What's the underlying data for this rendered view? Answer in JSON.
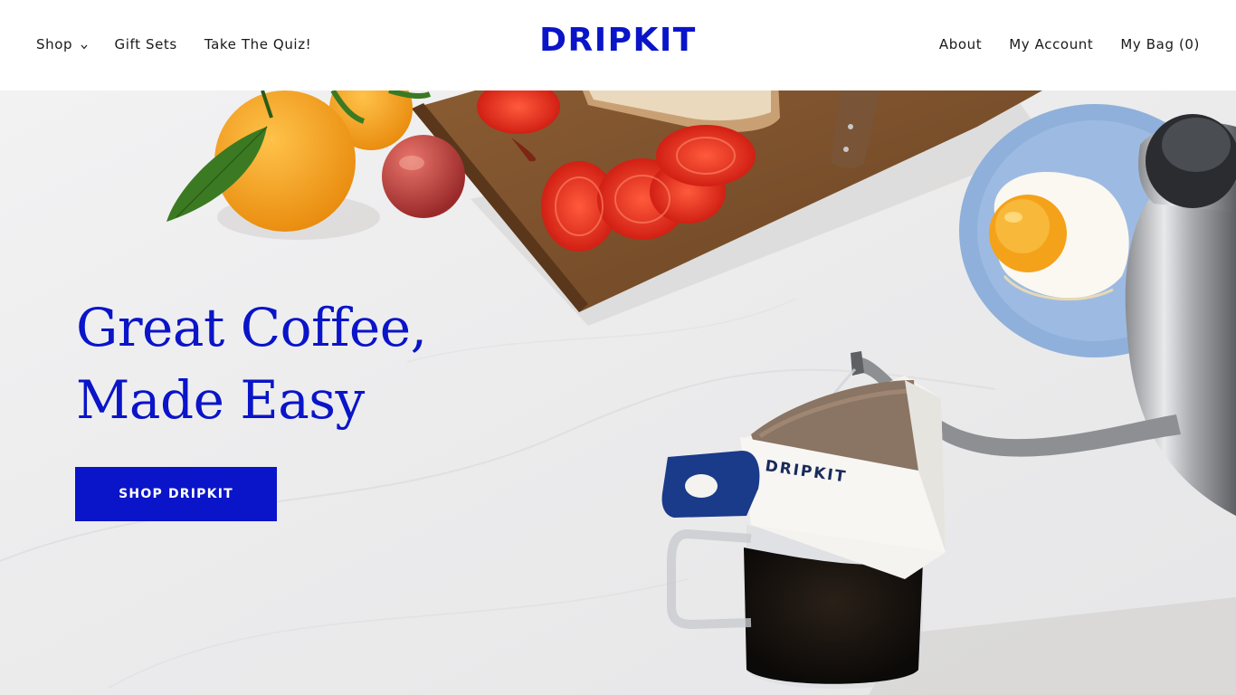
{
  "header": {
    "logo": "DRIPKIT",
    "nav_left": [
      {
        "label": "Shop",
        "has_dropdown": true
      },
      {
        "label": "Gift Sets"
      },
      {
        "label": "Take The Quiz!"
      }
    ],
    "nav_right": [
      {
        "label": "About"
      },
      {
        "label": "My Account"
      },
      {
        "label": "My Bag (0)"
      }
    ]
  },
  "hero": {
    "headline_line1": "Great Coffee,",
    "headline_line2": "Made Easy",
    "cta_label": "SHOP DRIPKIT",
    "product_label": "DRIPKIT"
  },
  "colors": {
    "brand_blue": "#0a14c8",
    "background_marble": "#eeeeef",
    "text_dark": "#1a1a1a"
  },
  "icons": {
    "shop_dropdown": "chevron-down-icon"
  }
}
